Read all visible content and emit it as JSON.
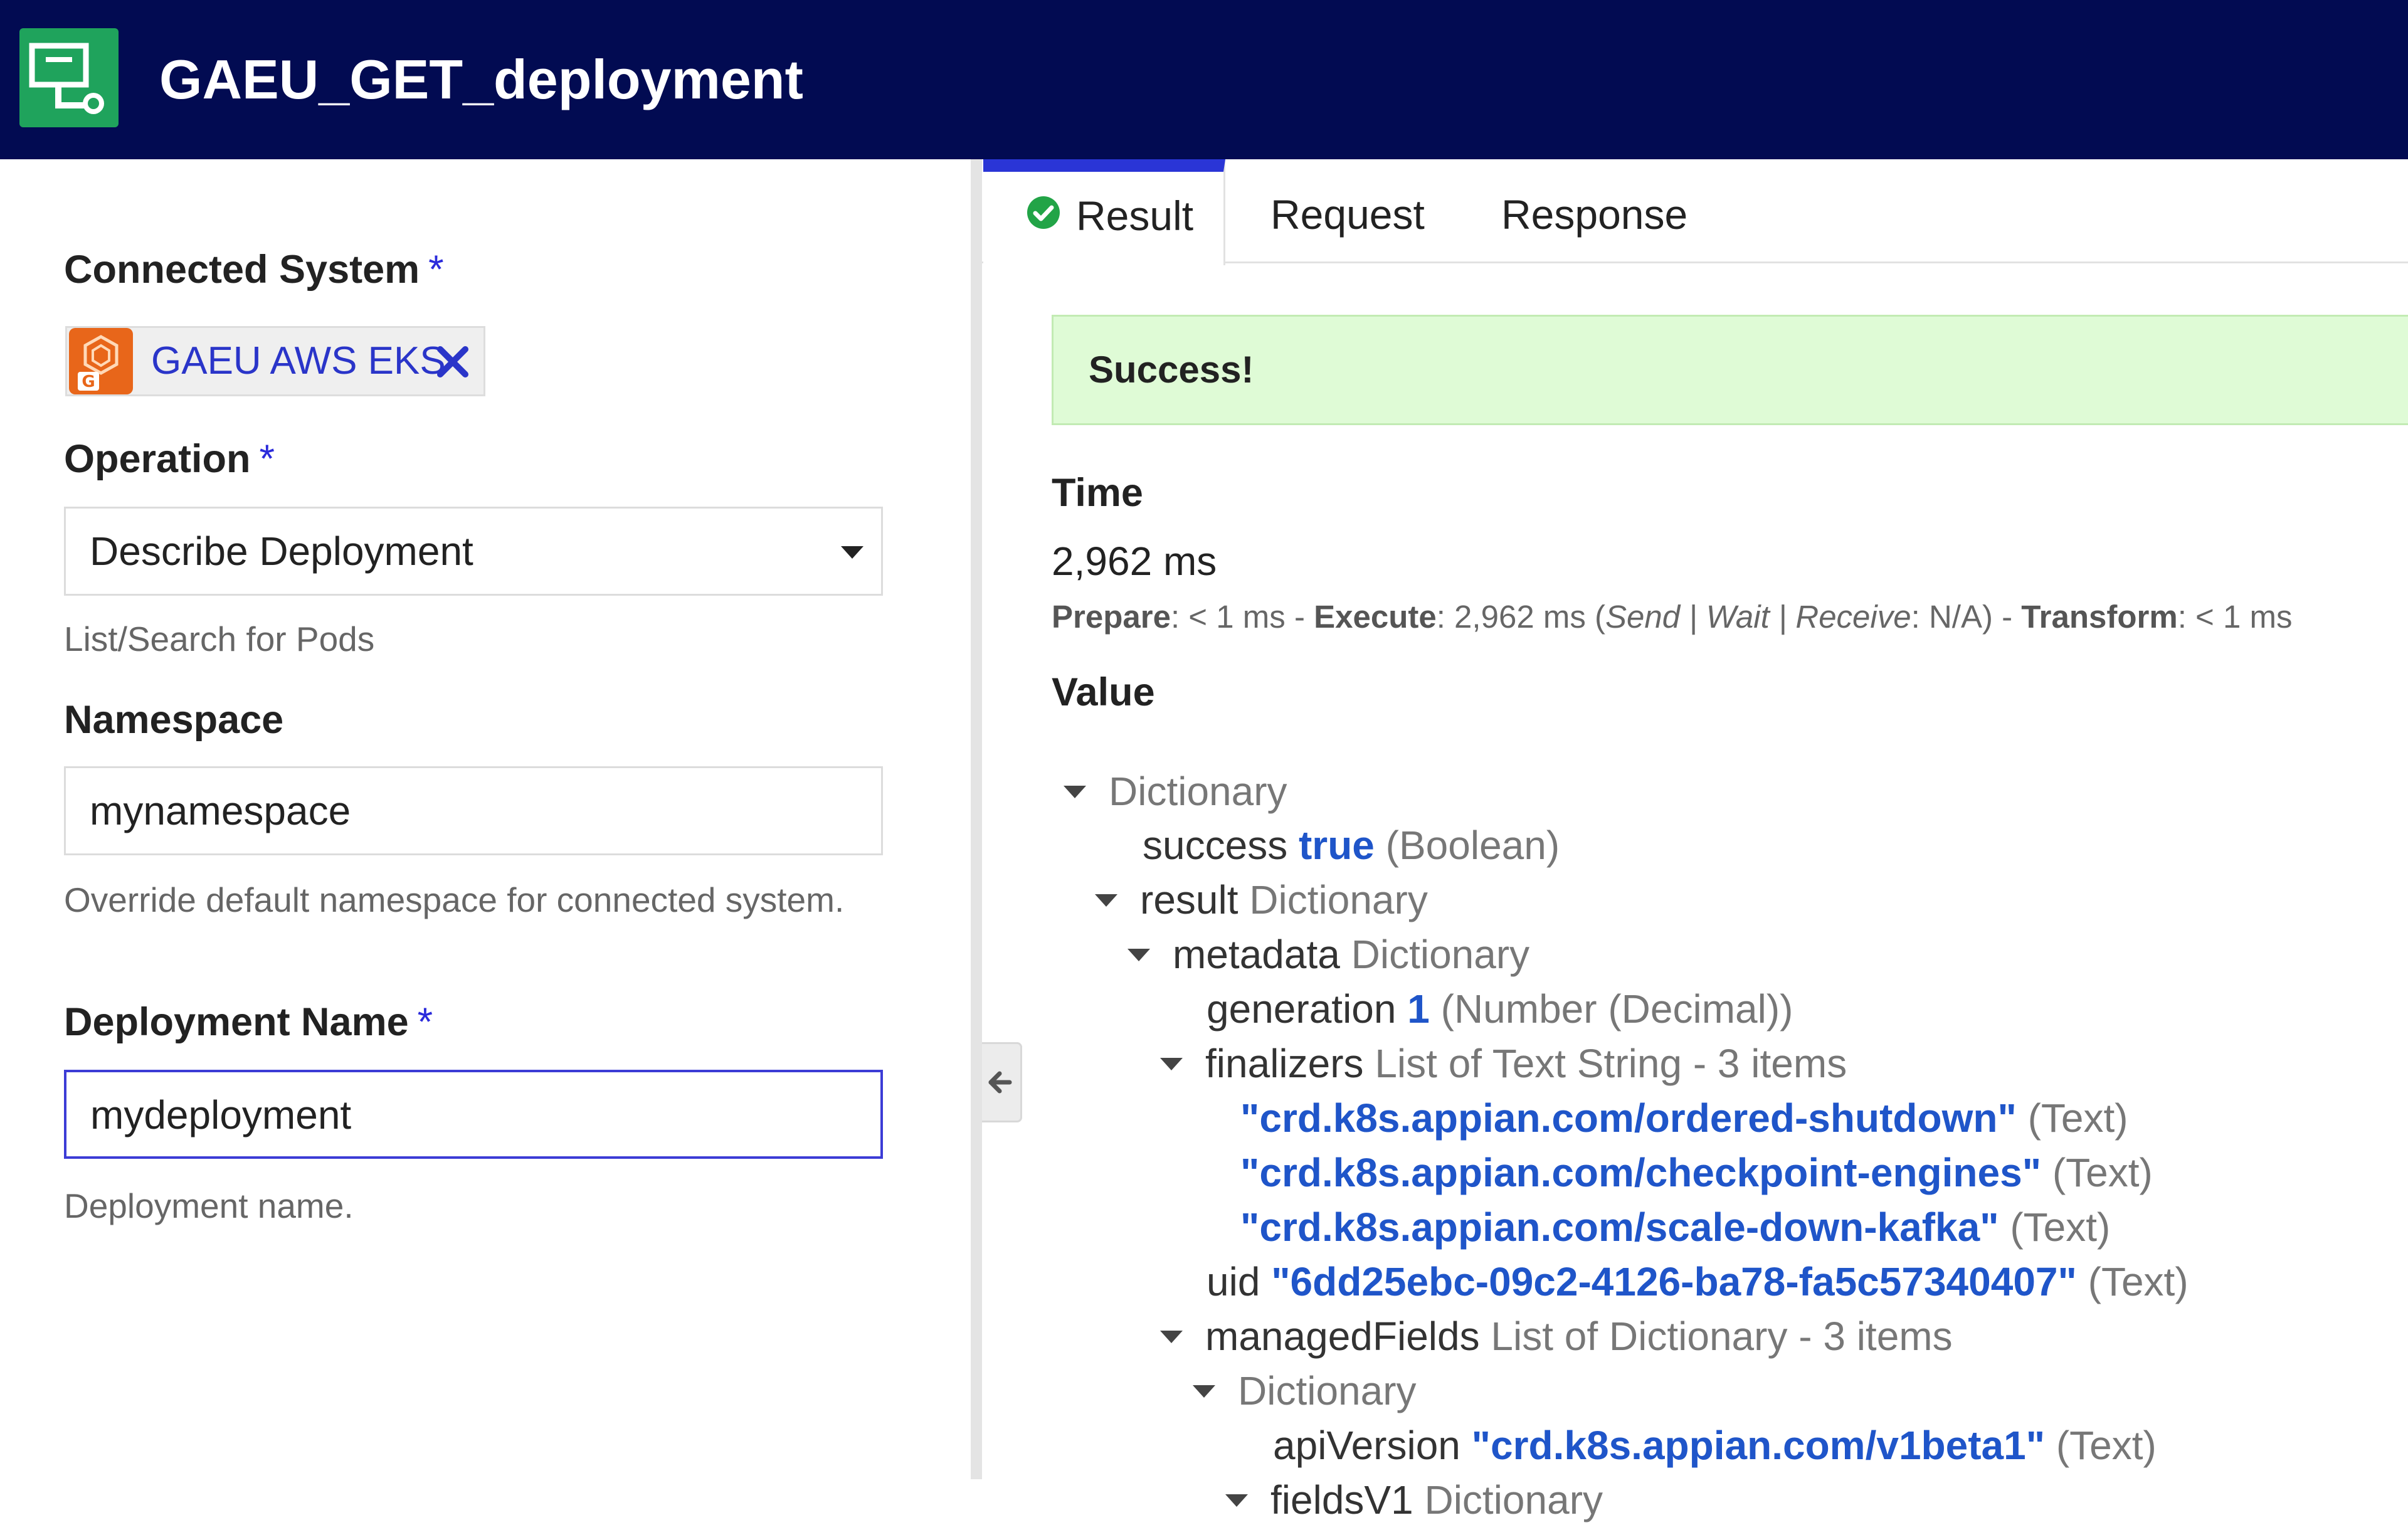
{
  "header": {
    "title": "GAEU_GET_deployment",
    "icon": "integration-icon",
    "background": "#020b52",
    "icon_color": "#1fa35c"
  },
  "form": {
    "connected_system": {
      "label": "Connected System",
      "required_mark": "*",
      "chip_label": "GAEU AWS EKS",
      "chip_icon": "aws-eks-icon",
      "remove_icon": "close-icon"
    },
    "operation": {
      "label": "Operation",
      "required_mark": "*",
      "value": "Describe Deployment",
      "help": "List/Search for Pods"
    },
    "namespace": {
      "label": "Namespace",
      "value": "mynamespace",
      "help": "Override default namespace for connected system."
    },
    "deployment_name": {
      "label": "Deployment Name",
      "required_mark": "*",
      "value": "mydeployment",
      "help": "Deployment name."
    }
  },
  "tabs": [
    {
      "label": "Result",
      "active": true,
      "icon": "check-circle-icon"
    },
    {
      "label": "Request",
      "active": false
    },
    {
      "label": "Response",
      "active": false
    }
  ],
  "result": {
    "status": "Success!",
    "time_title": "Time",
    "time_value": "2,962 ms",
    "time_detail": {
      "prepare_label": "Prepare",
      "prepare_value": ": < 1 ms - ",
      "execute_label": "Execute",
      "execute_value": ": 2,962 ms (",
      "send_wait_receive": "Send | Wait | Receive",
      "swr_value": ": N/A) - ",
      "transform_label": "Transform",
      "transform_value": ": < 1 ms"
    },
    "value_title": "Value",
    "tree": [
      {
        "key": "",
        "value": "",
        "type": "Dictionary",
        "expandable": true
      },
      {
        "key": "success",
        "value": "true",
        "type": "(Boolean)",
        "expandable": false
      },
      {
        "key": "result",
        "value": "",
        "type": "Dictionary",
        "expandable": true
      },
      {
        "key": "metadata",
        "value": "",
        "type": "Dictionary",
        "expandable": true
      },
      {
        "key": "generation",
        "value": "1",
        "type": "(Number (Decimal))",
        "expandable": false
      },
      {
        "key": "finalizers",
        "value": "",
        "type": "List of Text String - 3 items",
        "expandable": true
      },
      {
        "key": "",
        "value": "\"crd.k8s.appian.com/ordered-shutdown\"",
        "type": "(Text)",
        "expandable": false
      },
      {
        "key": "",
        "value": "\"crd.k8s.appian.com/checkpoint-engines\"",
        "type": "(Text)",
        "expandable": false
      },
      {
        "key": "",
        "value": "\"crd.k8s.appian.com/scale-down-kafka\"",
        "type": "(Text)",
        "expandable": false
      },
      {
        "key": "uid",
        "value": "\"6dd25ebc-09c2-4126-ba78-fa5c57340407\"",
        "type": "(Text)",
        "expandable": false
      },
      {
        "key": "managedFields",
        "value": "",
        "type": "List of Dictionary - 3 items",
        "expandable": true
      },
      {
        "key": "",
        "value": "",
        "type": "Dictionary",
        "expandable": true
      },
      {
        "key": "apiVersion",
        "value": "\"crd.k8s.appian.com/v1beta1\"",
        "type": "(Text)",
        "expandable": false
      },
      {
        "key": "fieldsV1",
        "value": "",
        "type": "Dictionary",
        "expandable": true
      }
    ]
  }
}
